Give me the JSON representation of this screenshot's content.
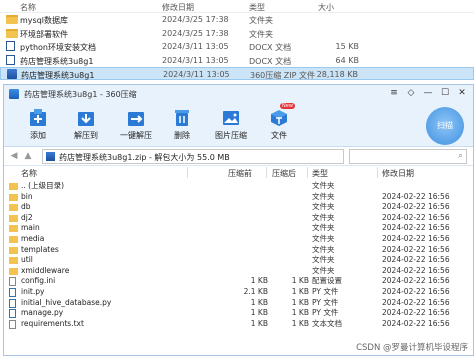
{
  "explorer": {
    "columns": {
      "name": "名称",
      "date": "修改日期",
      "type": "类型",
      "size": "大小"
    },
    "rows": [
      {
        "name": "mysql数据库",
        "date": "2024/3/25 17:38",
        "type": "文件夹",
        "size": "",
        "icon": "folder-icon"
      },
      {
        "name": "环境部署软件",
        "date": "2024/3/25 17:38",
        "type": "文件夹",
        "size": "",
        "icon": "folder-icon"
      },
      {
        "name": "python环境安装文档",
        "date": "2024/3/11 13:05",
        "type": "DOCX 文档",
        "size": "15 KB",
        "icon": "docx-icon"
      },
      {
        "name": "药店管理系统3u8g1",
        "date": "2024/3/11 13:05",
        "type": "DOCX 文档",
        "size": "64 KB",
        "icon": "docx-icon"
      },
      {
        "name": "药店管理系统3u8g1",
        "date": "2024/3/11 13:05",
        "type": "360压缩 ZIP 文件",
        "size": "28,118 KB",
        "icon": "zip-icon",
        "selected": true
      }
    ]
  },
  "window": {
    "title": "药店管理系统3u8g1 - 360压缩",
    "controls": {
      "menu": "≡",
      "skin": "◇",
      "minimize": "—",
      "maximize": "☐",
      "close": "✕"
    },
    "toolbar": [
      {
        "label": "添加",
        "icon": "add-icon"
      },
      {
        "label": "解压到",
        "icon": "extract-to-icon"
      },
      {
        "label": "一键解压",
        "icon": "one-click-extract-icon"
      },
      {
        "label": "删除",
        "icon": "delete-icon"
      },
      {
        "label": "图片压缩",
        "icon": "image-compress-icon"
      },
      {
        "label": "文件",
        "icon": "file-tool-icon",
        "badge": "New"
      }
    ],
    "scan_label": "扫描",
    "address": "药店管理系统3u8g1.zip - 解包大小为 55.0 MB",
    "list_columns": {
      "name": "名称",
      "size": "压缩前",
      "packed": "压缩后",
      "type": "类型",
      "date": "修改日期"
    },
    "files": [
      {
        "name": ".. (上级目录)",
        "size": "",
        "packed": "",
        "type": "文件夹",
        "date": "",
        "icon": "folder-icon"
      },
      {
        "name": "bin",
        "size": "",
        "packed": "",
        "type": "文件夹",
        "date": "2024-02-22 16:56",
        "icon": "folder-icon"
      },
      {
        "name": "db",
        "size": "",
        "packed": "",
        "type": "文件夹",
        "date": "2024-02-22 16:56",
        "icon": "folder-icon"
      },
      {
        "name": "dj2",
        "size": "",
        "packed": "",
        "type": "文件夹",
        "date": "2024-02-22 16:56",
        "icon": "folder-icon"
      },
      {
        "name": "main",
        "size": "",
        "packed": "",
        "type": "文件夹",
        "date": "2024-02-22 16:56",
        "icon": "folder-icon"
      },
      {
        "name": "media",
        "size": "",
        "packed": "",
        "type": "文件夹",
        "date": "2024-02-22 16:56",
        "icon": "folder-icon"
      },
      {
        "name": "templates",
        "size": "",
        "packed": "",
        "type": "文件夹",
        "date": "2024-02-22 16:56",
        "icon": "folder-icon"
      },
      {
        "name": "util",
        "size": "",
        "packed": "",
        "type": "文件夹",
        "date": "2024-02-22 16:56",
        "icon": "folder-icon"
      },
      {
        "name": "xmiddleware",
        "size": "",
        "packed": "",
        "type": "文件夹",
        "date": "2024-02-22 16:56",
        "icon": "folder-icon"
      },
      {
        "name": "config.ini",
        "size": "1 KB",
        "packed": "1 KB",
        "type": "配置设置",
        "date": "2024-02-22 16:56",
        "icon": "config-file-icon"
      },
      {
        "name": "init.py",
        "size": "2.1 KB",
        "packed": "1 KB",
        "type": "PY 文件",
        "date": "2024-02-22 16:56",
        "icon": "python-file-icon"
      },
      {
        "name": "initial_hive_database.py",
        "size": "1 KB",
        "packed": "1 KB",
        "type": "PY 文件",
        "date": "2024-02-22 16:56",
        "icon": "python-file-icon"
      },
      {
        "name": "manage.py",
        "size": "1 KB",
        "packed": "1 KB",
        "type": "PY 文件",
        "date": "2024-02-22 16:56",
        "icon": "python-file-icon"
      },
      {
        "name": "requirements.txt",
        "size": "1 KB",
        "packed": "1 KB",
        "type": "文本文档",
        "date": "2024-02-22 16:56",
        "icon": "text-file-icon"
      }
    ]
  },
  "watermark": "CSDN @罗曼计算机毕设程序",
  "colors": {
    "accent": "#2b7ad6",
    "folder": "#f3c34f",
    "toolbar_bg": "#e8f2fc",
    "selected": "#cce4f7"
  }
}
